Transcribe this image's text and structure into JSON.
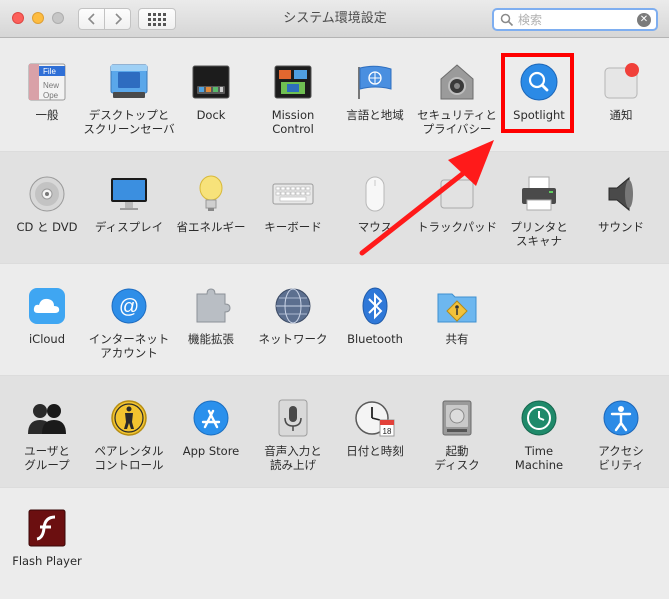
{
  "window": {
    "title": "システム環境設定",
    "search_placeholder": "検索"
  },
  "rows": [
    {
      "panes": [
        {
          "id": "general",
          "label": "一般",
          "icon": "general-icon",
          "file_label": "File",
          "new_label": "New",
          "open_label": "Ope"
        },
        {
          "id": "desktop",
          "label": "デスクトップと\nスクリーンセーバ",
          "icon": "desktop-screensaver-icon"
        },
        {
          "id": "dock",
          "label": "Dock",
          "icon": "dock-icon"
        },
        {
          "id": "mission",
          "label": "Mission\nControl",
          "icon": "mission-control-icon"
        },
        {
          "id": "language",
          "label": "言語と地域",
          "icon": "language-region-icon"
        },
        {
          "id": "security",
          "label": "セキュリティと\nプライバシー",
          "icon": "security-privacy-icon"
        },
        {
          "id": "spotlight",
          "label": "Spotlight",
          "icon": "spotlight-icon"
        },
        {
          "id": "notifications",
          "label": "通知",
          "icon": "notifications-icon"
        }
      ]
    },
    {
      "panes": [
        {
          "id": "cddvd",
          "label": "CD と DVD",
          "icon": "cd-dvd-icon"
        },
        {
          "id": "displays",
          "label": "ディスプレイ",
          "icon": "displays-icon"
        },
        {
          "id": "energy",
          "label": "省エネルギー",
          "icon": "energy-saver-icon"
        },
        {
          "id": "keyboard",
          "label": "キーボード",
          "icon": "keyboard-icon"
        },
        {
          "id": "mouse",
          "label": "マウス",
          "icon": "mouse-icon"
        },
        {
          "id": "trackpad",
          "label": "トラックパッド",
          "icon": "trackpad-icon"
        },
        {
          "id": "printers",
          "label": "プリンタと\nスキャナ",
          "icon": "printers-scanners-icon"
        },
        {
          "id": "sound",
          "label": "サウンド",
          "icon": "sound-icon"
        }
      ]
    },
    {
      "panes": [
        {
          "id": "icloud",
          "label": "iCloud",
          "icon": "icloud-icon"
        },
        {
          "id": "internet",
          "label": "インターネット\nアカウント",
          "icon": "internet-accounts-icon"
        },
        {
          "id": "extensions",
          "label": "機能拡張",
          "icon": "extensions-icon"
        },
        {
          "id": "network",
          "label": "ネットワーク",
          "icon": "network-icon"
        },
        {
          "id": "bluetooth",
          "label": "Bluetooth",
          "icon": "bluetooth-icon"
        },
        {
          "id": "sharing",
          "label": "共有",
          "icon": "sharing-icon"
        }
      ]
    },
    {
      "panes": [
        {
          "id": "users",
          "label": "ユーザと\nグループ",
          "icon": "users-groups-icon"
        },
        {
          "id": "parental",
          "label": "ペアレンタル\nコントロール",
          "icon": "parental-controls-icon"
        },
        {
          "id": "appstore",
          "label": "App Store",
          "icon": "app-store-icon"
        },
        {
          "id": "dictation",
          "label": "音声入力と\n読み上げ",
          "icon": "dictation-speech-icon"
        },
        {
          "id": "datetime",
          "label": "日付と時刻",
          "icon": "date-time-icon",
          "calendar_day": "18"
        },
        {
          "id": "startup",
          "label": "起動\nディスク",
          "icon": "startup-disk-icon"
        },
        {
          "id": "timemachine",
          "label": "Time\nMachine",
          "icon": "time-machine-icon"
        },
        {
          "id": "accessibility",
          "label": "アクセシ\nビリティ",
          "icon": "accessibility-icon"
        }
      ]
    },
    {
      "panes": [
        {
          "id": "flash",
          "label": "Flash Player",
          "icon": "flash-player-icon"
        }
      ]
    }
  ],
  "highlight": {
    "target": "spotlight",
    "color": "#ff0000"
  },
  "annotation_arrow": {
    "color": "#ff1a1a"
  }
}
